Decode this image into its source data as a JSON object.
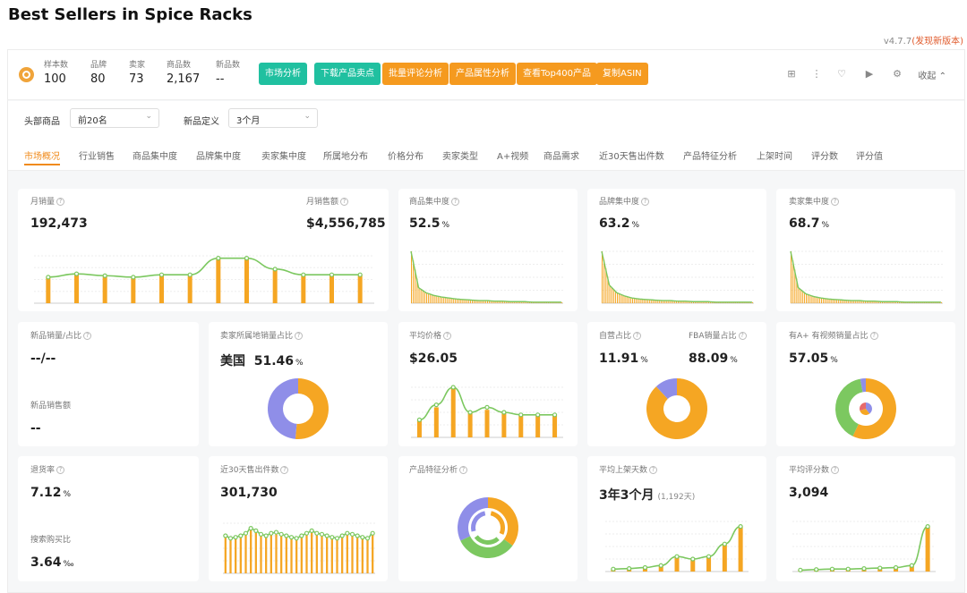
{
  "page": {
    "title": "Best Sellers in Spice Racks",
    "version": "v4.7.7",
    "version_link": "(发现新版本)"
  },
  "stats": [
    {
      "label": "样本数",
      "value": "100"
    },
    {
      "label": "品牌",
      "value": "80"
    },
    {
      "label": "卖家",
      "value": "73"
    },
    {
      "label": "商品数",
      "value": "2,167"
    },
    {
      "label": "新品数",
      "value": "--"
    }
  ],
  "actions": [
    "市场分析",
    "下载产品卖点",
    "批量评论分析",
    "产品属性分析",
    "查看Top400产品",
    "复制ASIN"
  ],
  "toolbar": {
    "collapse_label": "收起"
  },
  "filters": {
    "head_label": "头部商品",
    "head_value": "前20名",
    "new_label": "新品定义",
    "new_value": "3个月"
  },
  "tabs": [
    "市场概况",
    "行业销售",
    "商品集中度",
    "品牌集中度",
    "卖家集中度",
    "所属地分布",
    "价格分布",
    "卖家类型",
    "A+视频",
    "商品需求",
    "近30天售出件数",
    "产品特征分析",
    "上架时间",
    "评分数",
    "评分值"
  ],
  "colors": {
    "accent": "#f08a1a",
    "teal": "#20c0a0",
    "orange": "#f59a1f",
    "bar": "#f5a623",
    "line": "#7cc860",
    "purple": "#8f8ee8"
  },
  "cards": {
    "monthly_sales": {
      "label": "月销量",
      "value": "192,473"
    },
    "monthly_revenue": {
      "label": "月销售额",
      "value": "$4,556,785"
    },
    "product_conc": {
      "label": "商品集中度",
      "value": "52.5",
      "unit": "%"
    },
    "brand_conc": {
      "label": "品牌集中度",
      "value": "63.2",
      "unit": "%"
    },
    "seller_conc": {
      "label": "卖家集中度",
      "value": "68.7",
      "unit": "%"
    },
    "new_sales": {
      "label": "新品销量/占比",
      "value": "--/--",
      "label2": "新品销售额",
      "value2": "--"
    },
    "seller_origin": {
      "label": "卖家所属地销量占比",
      "country": "美国",
      "value": "51.46",
      "unit": "%"
    },
    "avg_price": {
      "label": "平均价格",
      "value": "$26.05"
    },
    "self_ship": {
      "label": "自营占比",
      "value": "11.91",
      "unit": "%",
      "label2": "FBA销量占比",
      "value2": "88.09",
      "unit2": "%"
    },
    "aplus": {
      "label": "有A+ 有视频销量占比",
      "value": "57.05",
      "unit": "%"
    },
    "return_rate": {
      "label": "退货率",
      "value": "7.12",
      "unit": "%",
      "label2": "搜索购买比",
      "value2": "3.64",
      "unit2": "‰"
    },
    "sold_30d": {
      "label": "近30天售出件数",
      "value": "301,730"
    },
    "features": {
      "label": "产品特征分析"
    },
    "avg_days": {
      "label": "平均上架天数",
      "value": "3年3个月",
      "sub": "(1,192天)"
    },
    "avg_ratings": {
      "label": "平均评分数",
      "value": "3,094"
    }
  },
  "chart_data": [
    {
      "type": "bar",
      "name": "monthly_sales_trend",
      "values": [
        0.55,
        0.62,
        0.58,
        0.55,
        0.6,
        0.6,
        0.95,
        0.95,
        0.72,
        0.6,
        0.6,
        0.6
      ],
      "line": [
        0.55,
        0.62,
        0.58,
        0.55,
        0.6,
        0.6,
        0.95,
        0.95,
        0.72,
        0.6,
        0.6,
        0.6
      ]
    },
    {
      "type": "area",
      "name": "product_concentration",
      "values": [
        1.0,
        0.3,
        0.2,
        0.15,
        0.12,
        0.1,
        0.08,
        0.07,
        0.06,
        0.05,
        0.05,
        0.04,
        0.04,
        0.03,
        0.03,
        0.03,
        0.02,
        0.02,
        0.02,
        0.02
      ]
    },
    {
      "type": "area",
      "name": "brand_concentration",
      "values": [
        1.0,
        0.35,
        0.2,
        0.14,
        0.1,
        0.08,
        0.07,
        0.06,
        0.05,
        0.05,
        0.04,
        0.04,
        0.03,
        0.03,
        0.03,
        0.02,
        0.02,
        0.02,
        0.02,
        0.02
      ]
    },
    {
      "type": "area",
      "name": "seller_concentration",
      "values": [
        1.0,
        0.3,
        0.18,
        0.13,
        0.1,
        0.08,
        0.07,
        0.06,
        0.05,
        0.05,
        0.04,
        0.04,
        0.03,
        0.03,
        0.03,
        0.02,
        0.02,
        0.02,
        0.02,
        0.02
      ]
    },
    {
      "type": "pie",
      "name": "seller_origin",
      "values": [
        51.46,
        48.54
      ],
      "colors": [
        "#f5a623",
        "#8f8ee8"
      ]
    },
    {
      "type": "bar",
      "name": "price_distribution",
      "values": [
        0.35,
        0.6,
        1.0,
        0.5,
        0.55,
        0.5,
        0.45,
        0.45,
        0.45
      ],
      "line": [
        0.35,
        0.65,
        1.0,
        0.5,
        0.6,
        0.5,
        0.45,
        0.45,
        0.45
      ]
    },
    {
      "type": "pie",
      "name": "self_ship",
      "values": [
        88.09,
        11.91
      ],
      "colors": [
        "#f5a623",
        "#8f8ee8"
      ]
    },
    {
      "type": "pie",
      "name": "aplus_video",
      "values": [
        57.05,
        40.0,
        2.95
      ],
      "colors": [
        "#f5a623",
        "#7cc860",
        "#8f8ee8"
      ]
    },
    {
      "type": "bar",
      "name": "sold_30d_trend",
      "values": [
        0.75,
        0.7,
        0.72,
        0.75,
        0.8,
        0.9,
        0.85,
        0.78,
        0.75,
        0.8,
        0.82,
        0.78,
        0.75,
        0.72,
        0.7,
        0.75,
        0.8,
        0.85,
        0.8,
        0.78,
        0.75,
        0.72,
        0.7,
        0.75,
        0.8,
        0.78,
        0.75,
        0.72,
        0.7,
        0.8
      ]
    },
    {
      "type": "pie",
      "name": "product_features",
      "values": [
        35,
        33,
        32
      ],
      "colors": [
        "#f5a623",
        "#7cc860",
        "#8f8ee8"
      ]
    },
    {
      "type": "bar",
      "name": "listing_days",
      "values": [
        0.05,
        0.06,
        0.08,
        0.12,
        0.3,
        0.25,
        0.3,
        0.55,
        0.9
      ],
      "line": [
        0.05,
        0.06,
        0.08,
        0.12,
        0.3,
        0.25,
        0.3,
        0.55,
        0.9
      ]
    },
    {
      "type": "bar",
      "name": "rating_count",
      "values": [
        0.03,
        0.04,
        0.05,
        0.05,
        0.06,
        0.07,
        0.08,
        0.12,
        0.9
      ],
      "line": [
        0.03,
        0.04,
        0.05,
        0.05,
        0.06,
        0.07,
        0.08,
        0.12,
        0.9
      ]
    }
  ]
}
